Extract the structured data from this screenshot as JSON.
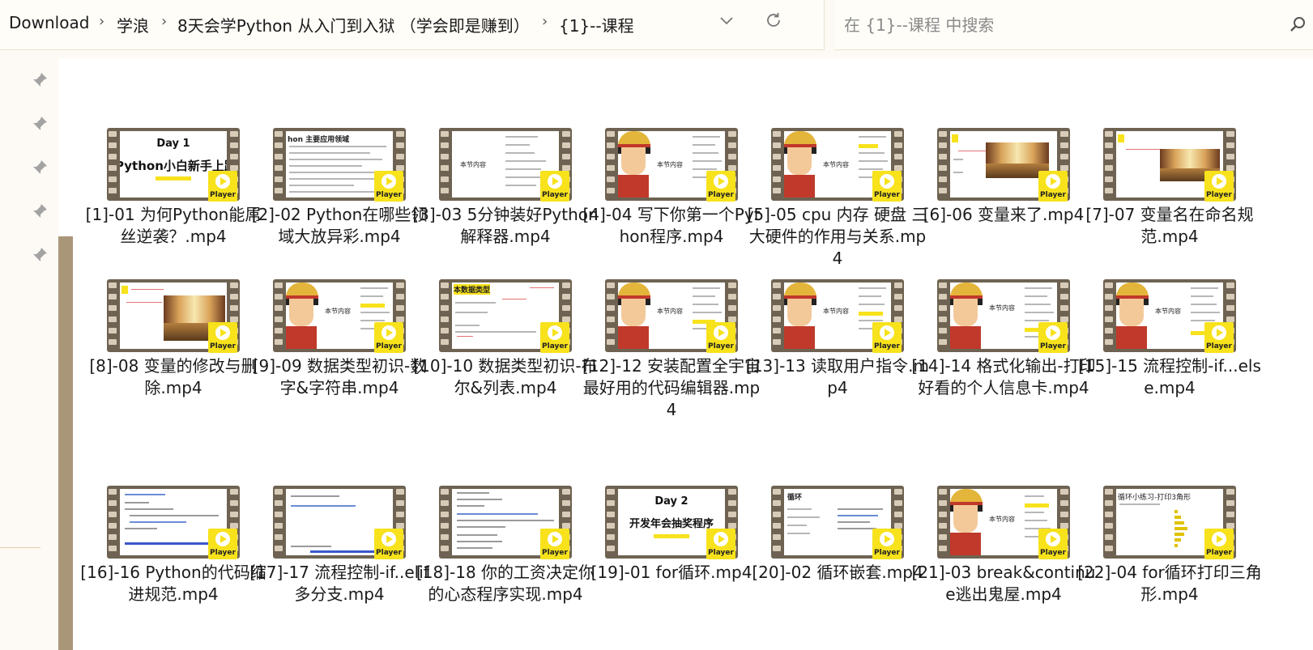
{
  "breadcrumb": {
    "items": [
      "Download",
      "学浪",
      "8天会学Python 从入门到入狱 （学会即是赚到）",
      "{1}--课程"
    ],
    "separator": "›"
  },
  "search": {
    "placeholder": "在 {1}--课程 中搜索"
  },
  "icons": {
    "dropdown": "chevron-down-icon",
    "refresh": "refresh-icon",
    "search": "search-icon",
    "pin": "pin-icon",
    "play": "play-icon"
  },
  "colors": {
    "badge": "#f7e21c",
    "scrollbar": "#a99679",
    "film": "#6e6352"
  },
  "slides": {
    "day1": "Day 1",
    "day1_sub": "Python小白新手上路",
    "day2": "Day 2",
    "day2_sub": "开发年会抽奖程序",
    "main_fields": "hon 主要应用领域",
    "section": "本节内容",
    "data_types": "本数据类型",
    "loop": "循环",
    "triangle": "循环小练习-打印3角形"
  },
  "files": [
    {
      "name": "[1]-01 为何Python能屌丝逆袭？.mp4",
      "badge": "Player"
    },
    {
      "name": "[2]-02 Python在哪些领域大放异彩.mp4",
      "badge": "Player"
    },
    {
      "name": "[3]-03 5分钟装好Python解释器.mp4",
      "badge": "Player"
    },
    {
      "name": "[4]-04 写下你第一个Python程序.mp4",
      "badge": "Player"
    },
    {
      "name": "[5]-05 cpu 内存 硬盘 三大硬件的作用与关系.mp4",
      "badge": "Player"
    },
    {
      "name": "[6]-06 变量来了.mp4",
      "badge": "Player"
    },
    {
      "name": "[7]-07 变量名在命名规范.mp4",
      "badge": "Player"
    },
    {
      "name": "[8]-08 变量的修改与删除.mp4",
      "badge": "Player"
    },
    {
      "name": "[9]-09 数据类型初识-数字&字符串.mp4",
      "badge": "Player"
    },
    {
      "name": "[10]-10 数据类型初识-布尔&列表.mp4",
      "badge": "Player"
    },
    {
      "name": "[12]-12 安装配置全宇宙最好用的代码编辑器.mp4",
      "badge": "Player"
    },
    {
      "name": "[13]-13 读取用户指令.mp4",
      "badge": "Player"
    },
    {
      "name": "[14]-14 格式化输出-打印好看的个人信息卡.mp4",
      "badge": "Player"
    },
    {
      "name": "[15]-15 流程控制-if...else.mp4",
      "badge": "Player"
    },
    {
      "name": "[16]-16 Python的代码缩进规范.mp4",
      "badge": "Player"
    },
    {
      "name": "[17]-17 流程控制-if..elif多分支.mp4",
      "badge": "Player"
    },
    {
      "name": "[18]-18 你的工资决定你的心态程序实现.mp4",
      "badge": "Player"
    },
    {
      "name": "[19]-01 for循环.mp4",
      "badge": "Player"
    },
    {
      "name": "[20]-02 循环嵌套.mp4",
      "badge": "Player"
    },
    {
      "name": "[21]-03 break&continue逃出鬼屋.mp4",
      "badge": "Player"
    },
    {
      "name": "[22]-04 for循环打印三角形.mp4",
      "badge": "Player"
    }
  ]
}
